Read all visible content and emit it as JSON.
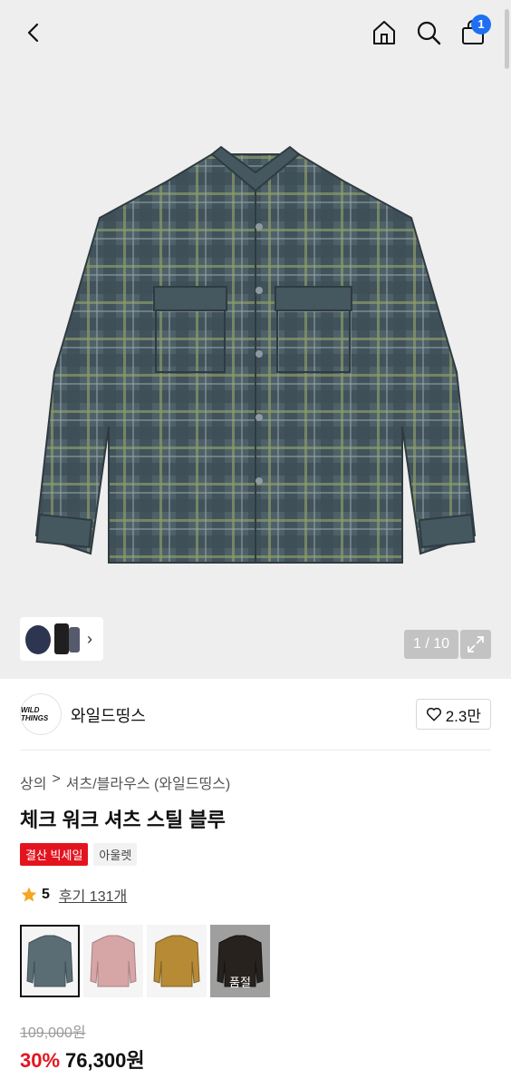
{
  "header": {
    "cart_count": "1"
  },
  "gallery": {
    "counter": "1 / 10"
  },
  "brand": {
    "logo_text": "WILD THINGS",
    "name": "와일드띵스",
    "likes": "2.3만"
  },
  "breadcrumb": {
    "category": "상의",
    "separator": ">",
    "subcategory": "셔츠/블라우스 (와일드띵스)"
  },
  "product": {
    "title": "체크 워크 셔츠 스틸 블루",
    "tags": [
      "결산 빅세일",
      "아울렛"
    ],
    "rating": "5",
    "reviews": "후기 131개",
    "color_options": [
      {
        "color": "#5b6d74",
        "sold_out": false
      },
      {
        "color": "#d6a5a6",
        "sold_out": false
      },
      {
        "color": "#b78a36",
        "sold_out": false
      },
      {
        "color": "#3d352d",
        "sold_out": true,
        "label": "품절"
      }
    ],
    "original_price": "109,000원",
    "discount": "30%",
    "sale_price": "76,300원"
  },
  "colors": {
    "accent_red": "#e4141f",
    "badge_blue": "#1e6ff1",
    "star": "#f5a623"
  }
}
